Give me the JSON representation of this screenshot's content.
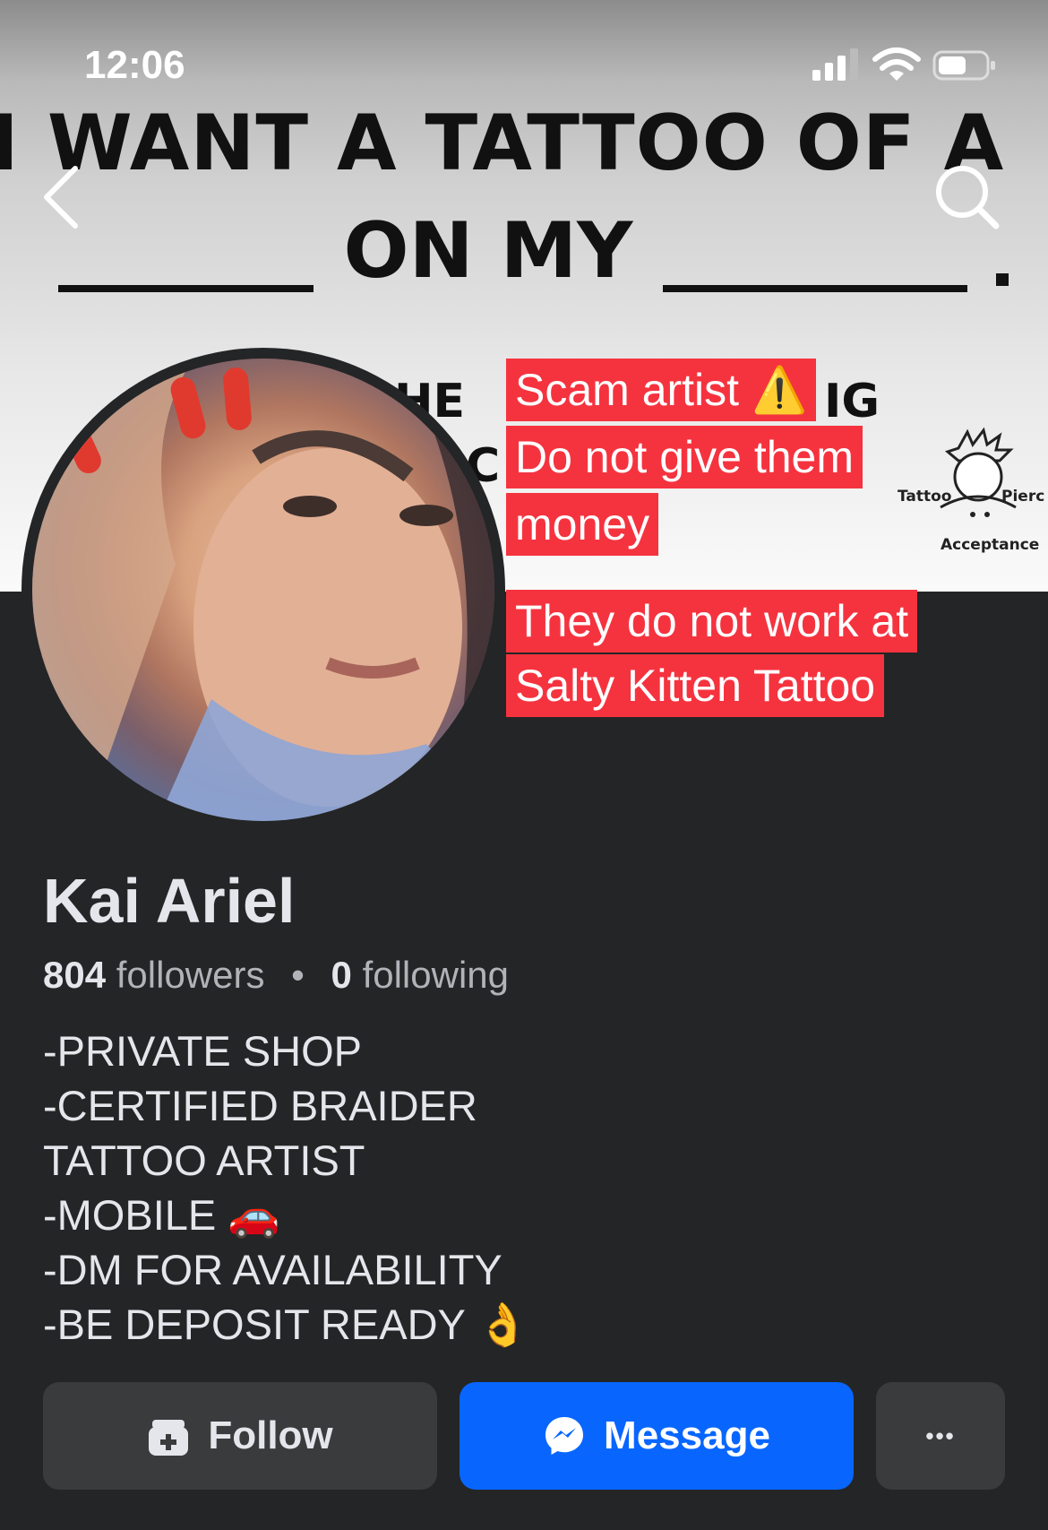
{
  "status_bar": {
    "time": "12:06"
  },
  "cover": {
    "line1": "I WANT A TATTOO OF A",
    "line2": "ON MY",
    "fragment_a": "HE",
    "fragment_b": "IG",
    "fragment_c": "C",
    "logo_left": "Tattoo",
    "logo_right": "Pierc",
    "logo_bottom": "Acceptance"
  },
  "overlay": {
    "warning_lines": [
      "Scam artist ⚠️",
      "Do not give them",
      "money"
    ],
    "note_lines": [
      "They do not work at",
      "Salty Kitten Tattoo"
    ]
  },
  "profile": {
    "name": "Kai Ariel",
    "followers_count": "804",
    "followers_label": "followers",
    "separator": "•",
    "following_count": "0",
    "following_label": "following",
    "bio": [
      "-PRIVATE SHOP",
      "-CERTIFIED BRAIDER",
      "TATTOO ARTIST",
      "-MOBILE 🚗",
      "-DM FOR AVAILABILITY",
      "-BE DEPOSIT READY 👌"
    ]
  },
  "actions": {
    "follow_label": "Follow",
    "message_label": "Message",
    "more_label": "•••"
  },
  "icons": [
    "back-icon",
    "search-icon",
    "signal-icon",
    "wifi-icon",
    "battery-icon",
    "follow-icon",
    "messenger-icon"
  ],
  "colors": {
    "background": "#242526",
    "accent": "#0866ff",
    "warning": "#f5333f",
    "secondary_button": "#3a3b3c"
  }
}
